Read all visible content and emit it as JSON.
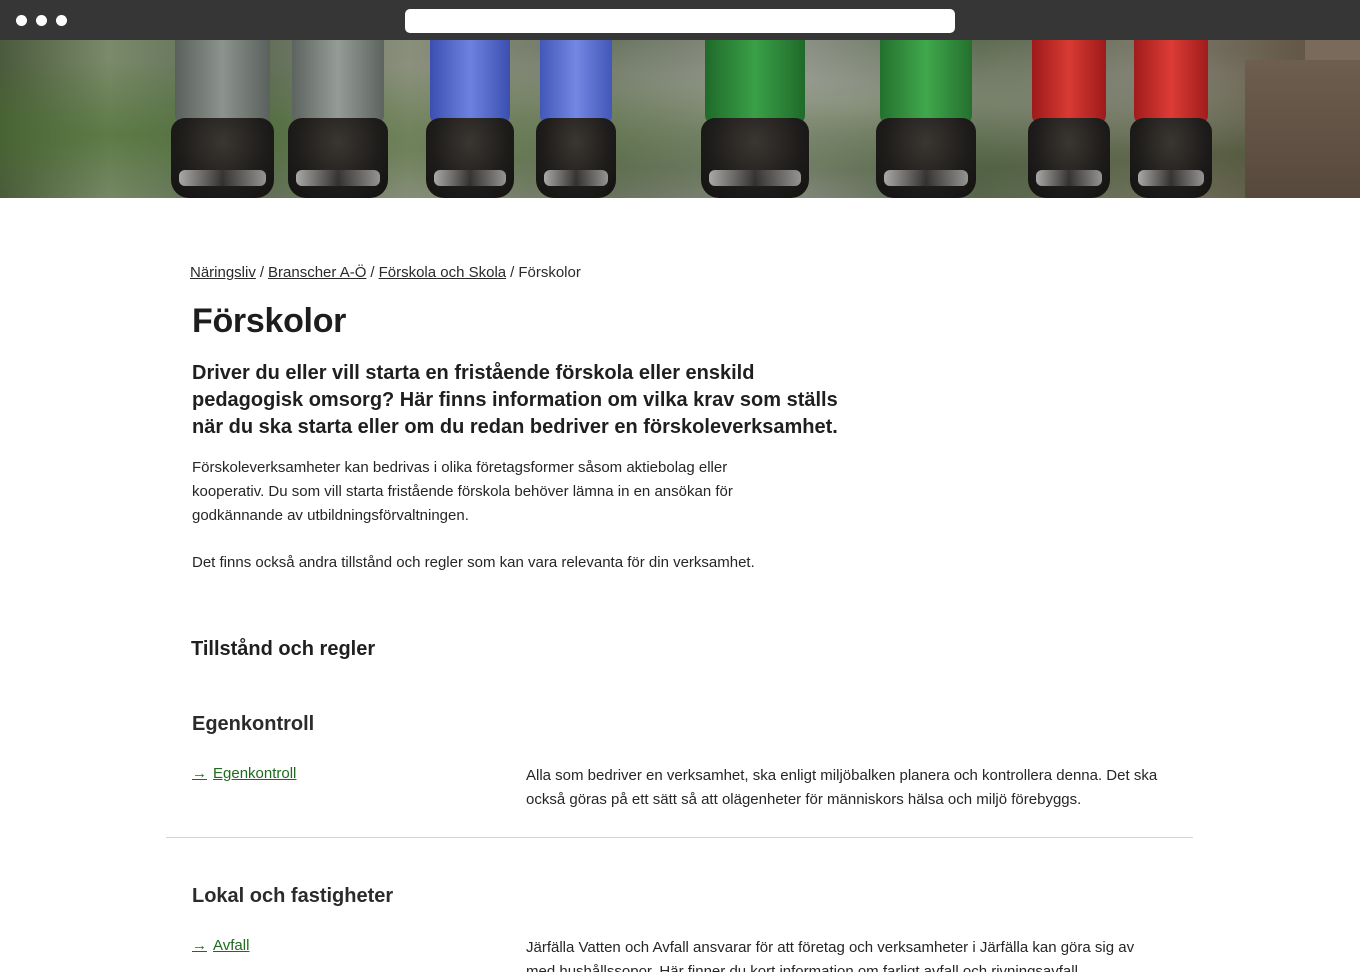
{
  "breadcrumb": {
    "items": [
      "Näringsliv",
      "Branscher A-Ö",
      "Förskola och Skola"
    ],
    "current": "Förskolor",
    "separator": "/"
  },
  "page": {
    "title": "Förskolor",
    "lead": "Driver du eller vill starta en fristående förskola eller enskild pedagogisk omsorg? Här finns information om vilka krav som ställs när du ska starta eller om du redan bedriver en förskoleverksamhet.",
    "paragraph1": "Förskoleverksamheter kan bedrivas i olika företagsformer såsom aktiebolag eller kooperativ. Du som vill starta fristående förskola behöver lämna in en ansökan för godkännande av utbildningsförvaltningen.",
    "paragraph2": "Det finns också andra tillstånd och regler som kan vara relevanta för din verksamhet."
  },
  "section": {
    "title": "Tillstånd och regler",
    "groups": [
      {
        "title": "Egenkontroll",
        "link_label": "Egenkontroll",
        "description": "Alla som bedriver en verksamhet, ska enligt miljöbalken planera och kontrollera denna. Det ska också göras på ett sätt så att olägenheter för människors hälsa och miljö förebyggs."
      },
      {
        "title": "Lokal och fastigheter",
        "link_label": "Avfall",
        "description": "Järfälla Vatten och Avfall ansvarar för att företag och verksamheter i Järfälla kan göra sig av med hushållssopor. Här finner du kort information om farligt avfall och rivningsavfall."
      }
    ]
  },
  "icons": {
    "link_arrow": "→"
  },
  "colors": {
    "link_green": "#1d6b1d",
    "chrome_bg": "#363636"
  }
}
